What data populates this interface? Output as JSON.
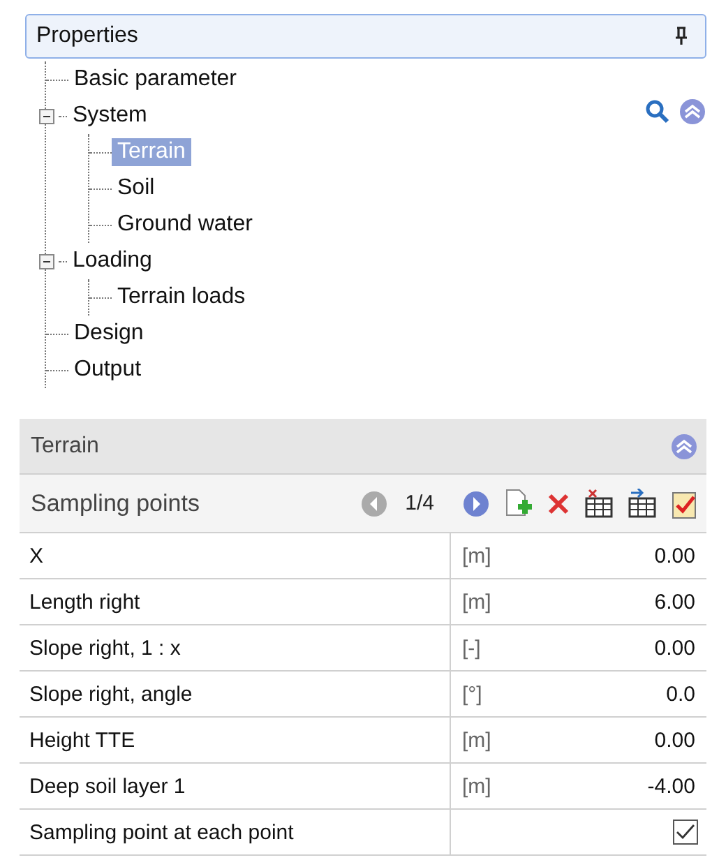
{
  "panel": {
    "title": "Properties"
  },
  "tree": [
    {
      "label": "Basic parameter",
      "selected": false
    },
    {
      "label": "System",
      "selected": false,
      "expanded": true,
      "children": [
        {
          "label": "Terrain",
          "selected": true
        },
        {
          "label": "Soil",
          "selected": false
        },
        {
          "label": "Ground water",
          "selected": false
        }
      ]
    },
    {
      "label": "Loading",
      "selected": false,
      "expanded": true,
      "children": [
        {
          "label": "Terrain loads",
          "selected": false
        }
      ]
    },
    {
      "label": "Design",
      "selected": false
    },
    {
      "label": "Output",
      "selected": false
    }
  ],
  "section": {
    "title": "Terrain",
    "subheader": {
      "title": "Sampling points",
      "page": "1/4"
    },
    "rows": [
      {
        "kind": "value",
        "label": "X",
        "unit": "[m]",
        "value": "0.00"
      },
      {
        "kind": "value",
        "label": "Length right",
        "unit": "[m]",
        "value": "6.00"
      },
      {
        "kind": "value",
        "label": "Slope right, 1 : x",
        "unit": "[-]",
        "value": "0.00"
      },
      {
        "kind": "value",
        "label": "Slope right, angle",
        "unit": "[°]",
        "value": "0.0"
      },
      {
        "kind": "value",
        "label": "Height TTE",
        "unit": "[m]",
        "value": "0.00"
      },
      {
        "kind": "value",
        "label": "Deep soil layer 1",
        "unit": "[m]",
        "value": "-4.00"
      },
      {
        "kind": "checkbox",
        "label": "Sampling point at each point",
        "checked": true
      }
    ]
  }
}
